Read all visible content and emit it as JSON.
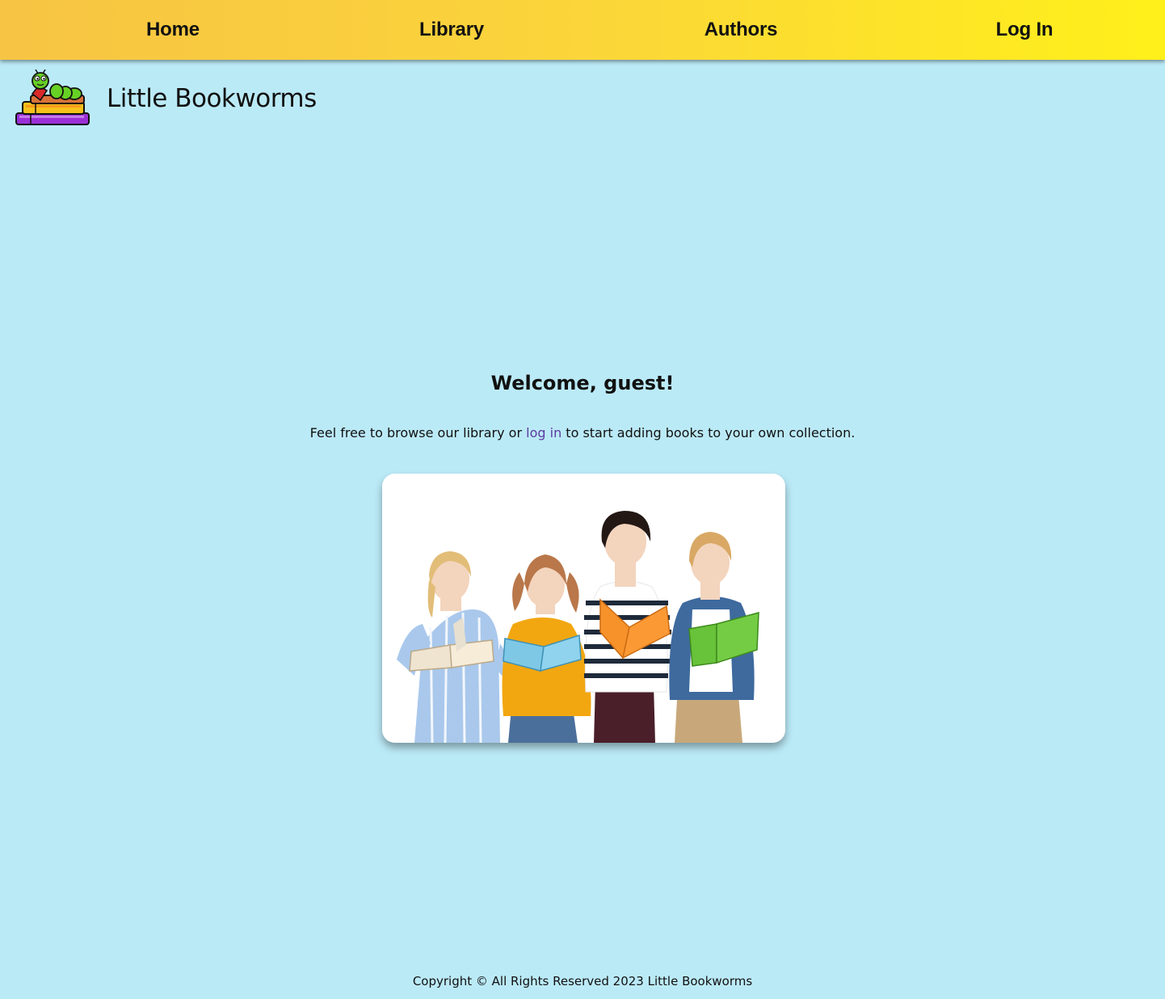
{
  "nav": {
    "items": [
      {
        "label": "Home"
      },
      {
        "label": "Library"
      },
      {
        "label": "Authors"
      },
      {
        "label": "Log In"
      }
    ]
  },
  "brand": {
    "title": "Little Bookworms",
    "logo_icon": "bookworm-on-books-icon"
  },
  "main": {
    "heading": "Welcome, guest!",
    "intro_before": "Feel free to browse our library or ",
    "intro_link": "log in",
    "intro_after": " to start adding books to your own collection.",
    "hero_image": "children-reading-books-photo"
  },
  "footer": {
    "text": "Copyright © All Rights Reserved 2023 Little Bookworms"
  },
  "colors": {
    "background": "#bbeaf7",
    "nav_gradient_start": "#f7c443",
    "nav_gradient_end": "#fff01a",
    "link": "#5b3aa0"
  }
}
